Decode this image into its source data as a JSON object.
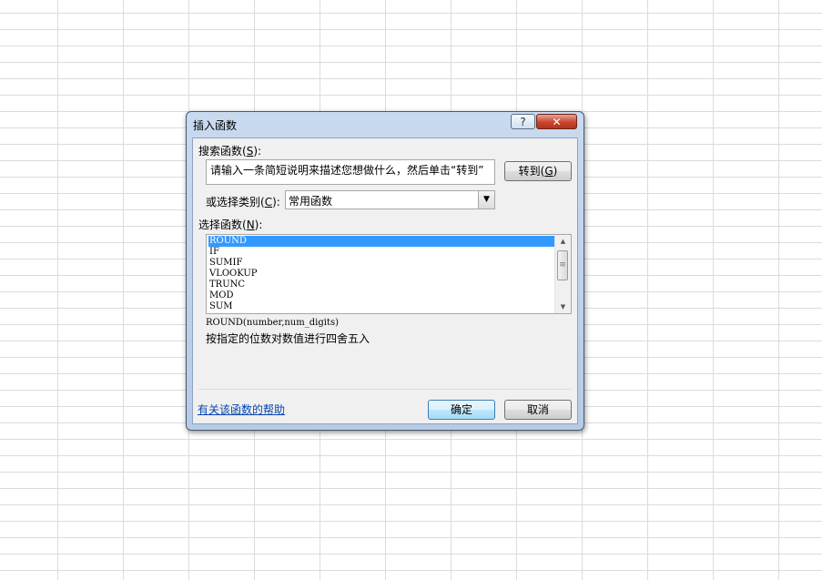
{
  "dialog": {
    "title": "插入函数",
    "help_glyph": "?",
    "close_glyph": "✕",
    "search_label": "搜索函数(",
    "search_key": "S",
    "search_label_end": "):",
    "search_value": "请输入一条简短说明来描述您想做什么，然后单击“转到”",
    "goto_label": "转到(",
    "goto_key": "G",
    "goto_label_end": ")",
    "category_label": "或选择类别(",
    "category_key": "C",
    "category_label_end": "):",
    "category_value": "常用函数",
    "function_label": "选择函数(",
    "function_key": "N",
    "function_label_end": "):",
    "functions": [
      "ROUND",
      "IF",
      "SUMIF",
      "VLOOKUP",
      "TRUNC",
      "MOD",
      "SUM"
    ],
    "selected_function": "ROUND",
    "syntax": "ROUND(number,num_digits)",
    "description": "按指定的位数对数值进行四舍五入",
    "help_link": "有关该函数的帮助",
    "ok_label": "确定",
    "cancel_label": "取消"
  },
  "icons": {
    "dropdown_arrow": "▼",
    "scroll_up": "▲",
    "scroll_down": "▼",
    "scroll_grip": "≡"
  }
}
